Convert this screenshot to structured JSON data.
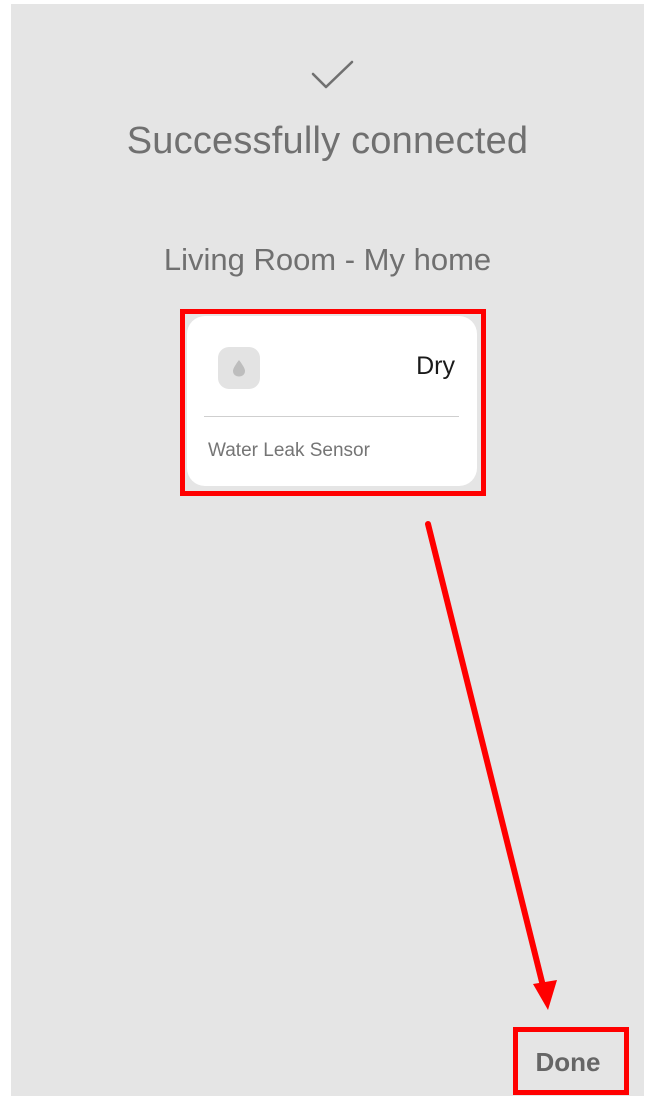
{
  "header": {
    "check_icon": "checkmark-icon",
    "title": "Successfully connected",
    "location": "Living Room - My home"
  },
  "device_card": {
    "icon": "water-drop-icon",
    "status": "Dry",
    "name": "Water Leak Sensor"
  },
  "footer": {
    "done_label": "Done"
  },
  "annotations": {
    "highlight_color": "#ff0000",
    "arrow": "from device card to Done button"
  }
}
